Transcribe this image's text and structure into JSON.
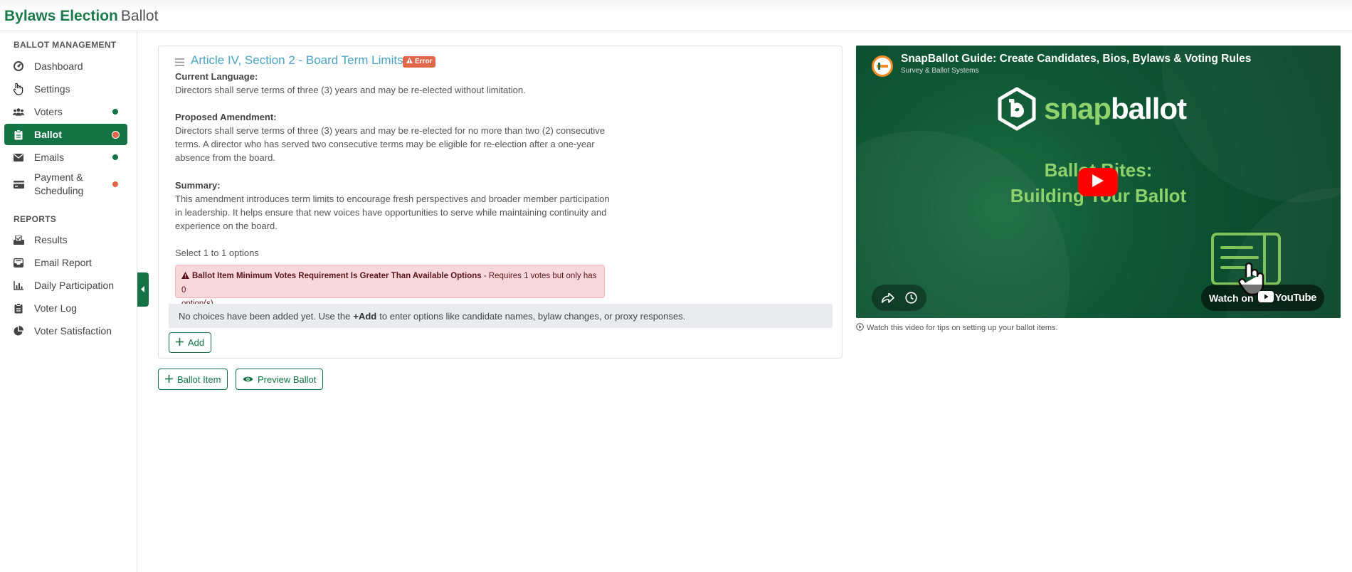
{
  "header": {
    "title": "Bylaws Election",
    "subtitle": "Ballot"
  },
  "sidebar": {
    "ballot_management_heading": "BALLOT MANAGEMENT",
    "reports_heading": "REPORTS",
    "management_items": [
      {
        "label": "Dashboard",
        "icon": "dashboard-icon",
        "status": ""
      },
      {
        "label": "Settings",
        "icon": "settings-icon",
        "status": ""
      },
      {
        "label": "Voters",
        "icon": "users-icon",
        "status": "complete"
      },
      {
        "label": "Ballot",
        "icon": "clipboard-icon",
        "status": "error",
        "active": true
      },
      {
        "label": "Emails",
        "icon": "envelope-icon",
        "status": "complete"
      },
      {
        "label": "Payment & Scheduling",
        "icon": "credit-card-icon",
        "status": "error"
      }
    ],
    "report_items": [
      {
        "label": "Results",
        "icon": "vote-check-icon"
      },
      {
        "label": "Email Report",
        "icon": "inbox-icon"
      },
      {
        "label": "Daily Participation",
        "icon": "bar-chart-icon"
      },
      {
        "label": "Voter Log",
        "icon": "clipboard-list-icon"
      },
      {
        "label": "Voter Satisfaction",
        "icon": "pie-chart-icon"
      }
    ],
    "colors": {
      "active_bg": "#137344",
      "status_complete": "#137344",
      "status_error": "#e0674b"
    }
  },
  "ballot_item": {
    "title": "Article IV, Section 2 - Board Term Limits",
    "badge": "Error",
    "current_language_label": "Current Language:",
    "current_language": "Directors shall serve terms of three (3) years and may be re-elected without limitation.",
    "proposed_label": "Proposed Amendment:",
    "proposed_lines": [
      "Directors shall serve terms of three (3) years and may be re-elected for no more than two (2) consecutive",
      "terms. A director who has served two consecutive terms may be eligible for re-election after a one-year",
      "absence from the board."
    ],
    "summary_label": "Summary:",
    "summary_lines": [
      "This amendment introduces term limits to encourage fresh perspectives and broader member participation",
      "in leadership. It helps ensure that new voices have opportunities to serve while maintaining continuity and",
      "experience on the board."
    ],
    "select_hint": "Select 1 to 1 options",
    "alert_title": "Ballot Item Minimum Votes Requirement Is Greater Than Available Options",
    "alert_detail": " - Requires 1 votes but only has 0",
    "alert_detail2": "option(s).",
    "empty_before": "No choices have been added yet. Use the",
    "empty_strong": "+Add",
    "empty_after": "to enter options like candidate names, bylaw changes, or proxy responses.",
    "add_label": "Add"
  },
  "actions": {
    "ballot_item_label": "Ballot Item",
    "preview_label": "Preview Ballot"
  },
  "video": {
    "title": "SnapBallot Guide: Create Candidates, Bios, Bylaws & Voting Rules",
    "channel": "Survey & Ballot Systems",
    "logo_snap": "snap",
    "logo_ballot": "ballot",
    "headline1": "Ballot Bites:",
    "headline2": "Building Your Ballot",
    "watch_on": "Watch on",
    "youtube": "YouTube",
    "caption": "Watch this video for tips on setting up your ballot items."
  }
}
